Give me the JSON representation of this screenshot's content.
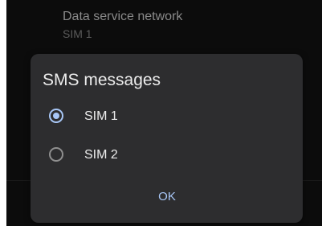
{
  "background": {
    "title": "Data service network",
    "subtitle": "SIM 1"
  },
  "dialog": {
    "title": "SMS messages",
    "options": [
      {
        "label": "SIM 1",
        "selected": true
      },
      {
        "label": "SIM 2",
        "selected": false
      }
    ],
    "ok_label": "OK"
  },
  "colors": {
    "accent": "#a8c7f7",
    "dialog_bg": "#2d2d2f",
    "screen_bg": "#0c0c0c"
  }
}
